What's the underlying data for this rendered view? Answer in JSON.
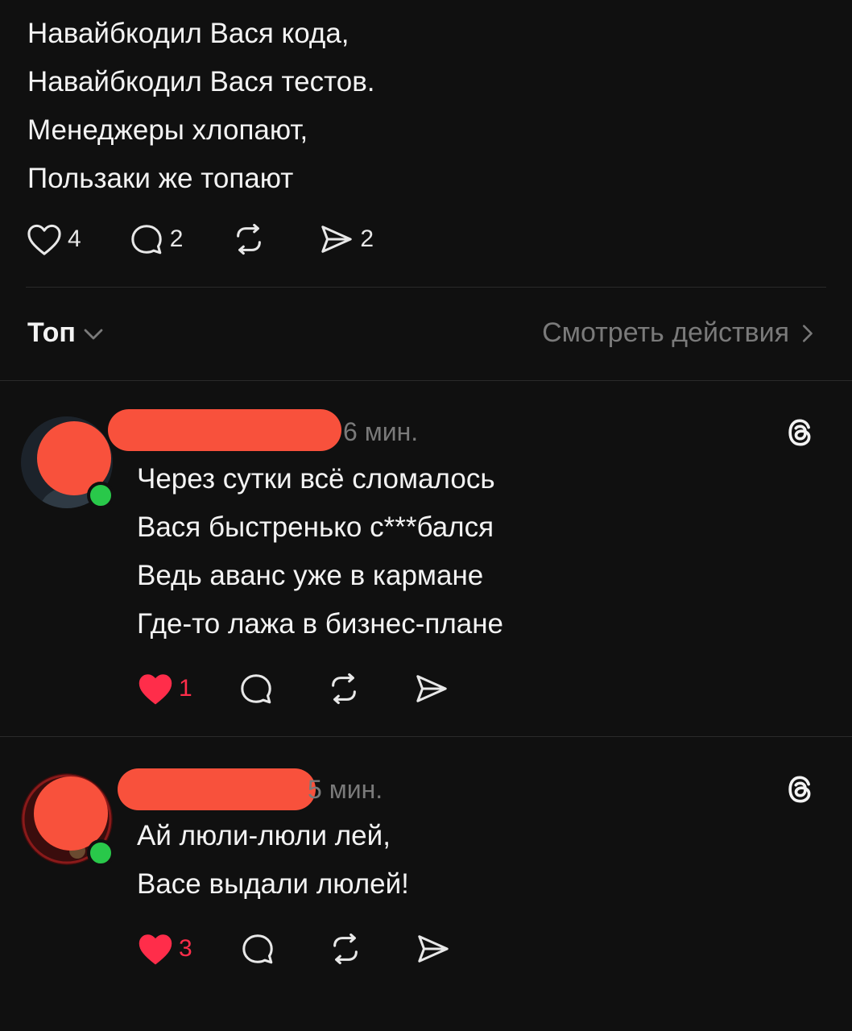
{
  "post": {
    "lines": [
      "Навайбкодил Вася кода,",
      "Навайбкодил Вася тестов.",
      "Менеджеры хлопают,",
      "Пользаки же топают"
    ],
    "likes": "4",
    "replies": "2",
    "shares": "2"
  },
  "filter": {
    "sort_label": "Топ",
    "activity_label": "Смотреть действия"
  },
  "comments": [
    {
      "time": "6 мин.",
      "lines": [
        "Через сутки всё сломалось",
        "Вася быстренько с***бался",
        "Ведь аванс уже в кармане",
        "Где-то лажа в бизнес-плане"
      ],
      "likes": "1"
    },
    {
      "time": "5 мин.",
      "lines": [
        "Ай люли-люли лей,",
        "Васе выдали люлей!"
      ],
      "likes": "3"
    }
  ],
  "colors": {
    "background": "#101010",
    "liked": "#ff2d4a",
    "muted": "#7a7a7a",
    "online": "#29c84a",
    "redaction": "#f8513c"
  }
}
